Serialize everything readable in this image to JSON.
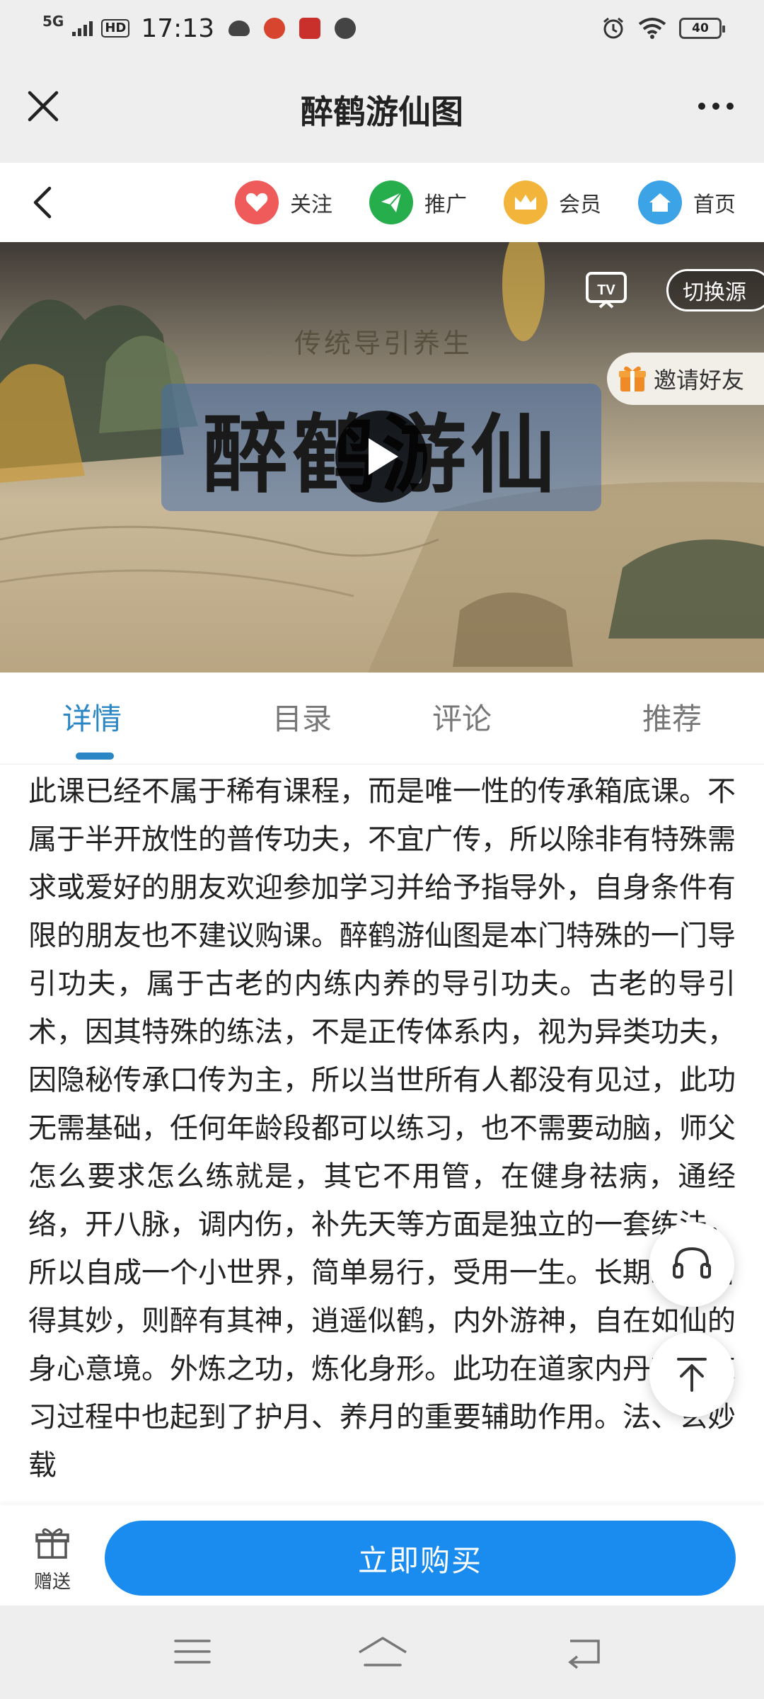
{
  "status_bar": {
    "network": "5G",
    "hd": "HD",
    "time": "17:13",
    "battery": "40"
  },
  "header": {
    "title": "醉鹤游仙图"
  },
  "nav": {
    "items": [
      {
        "label": "关注",
        "icon": "heart-icon",
        "color": "#ef5a5a"
      },
      {
        "label": "推广",
        "icon": "paper-plane-icon",
        "color": "#27ae4c"
      },
      {
        "label": "会员",
        "icon": "crown-icon",
        "color": "#f2b43a"
      },
      {
        "label": "首页",
        "icon": "home-icon",
        "color": "#3ba3e6"
      }
    ]
  },
  "video": {
    "subtitle": "传统导引养生",
    "title": "醉鹤游仙",
    "switch_source": "切换源",
    "invite": "邀请好友"
  },
  "tabs": [
    {
      "label": "详情",
      "active": true
    },
    {
      "label": "目录",
      "active": false
    },
    {
      "label": "评论",
      "active": false
    },
    {
      "label": "推荐",
      "active": false
    }
  ],
  "content": {
    "text": "此课已经不属于稀有课程，而是唯一性的传承箱底课。不属于半开放性的普传功夫，不宜广传，所以除非有特殊需求或爱好的朋友欢迎参加学习并给予指导外，自身条件有限的朋友也不建议购课。醉鹤游仙图是本门特殊的一门导引功夫，属于古老的内练内养的导引功夫。古老的导引术，因其特殊的练法，不是正传体系内，视为异类功夫，因隐秘传承口传为主，所以当世所有人都没有见过，此功无需基础，任何年龄段都可以练习，也不需要动脑，师父怎么要求怎么练就是，其它不用管，在健身祛病，通经络，开八脉，调内伤，补先天等方面是独立的一套练法，所以自成一个小世界，简单易行，受用一生。长期练习自得其妙，则醉有其神，逍遥似鹤，内外游神，自在如仙的身心意境。外炼之功，炼化身形。此功在道家内丹功的练习过程中也起到了护月、养月的重要辅助作用。法、玄妙载"
  },
  "bottom": {
    "gift_label": "赠送",
    "buy_label": "立即购买"
  },
  "colors": {
    "accent": "#2b86c5",
    "buy_button": "#1a8cf0"
  }
}
